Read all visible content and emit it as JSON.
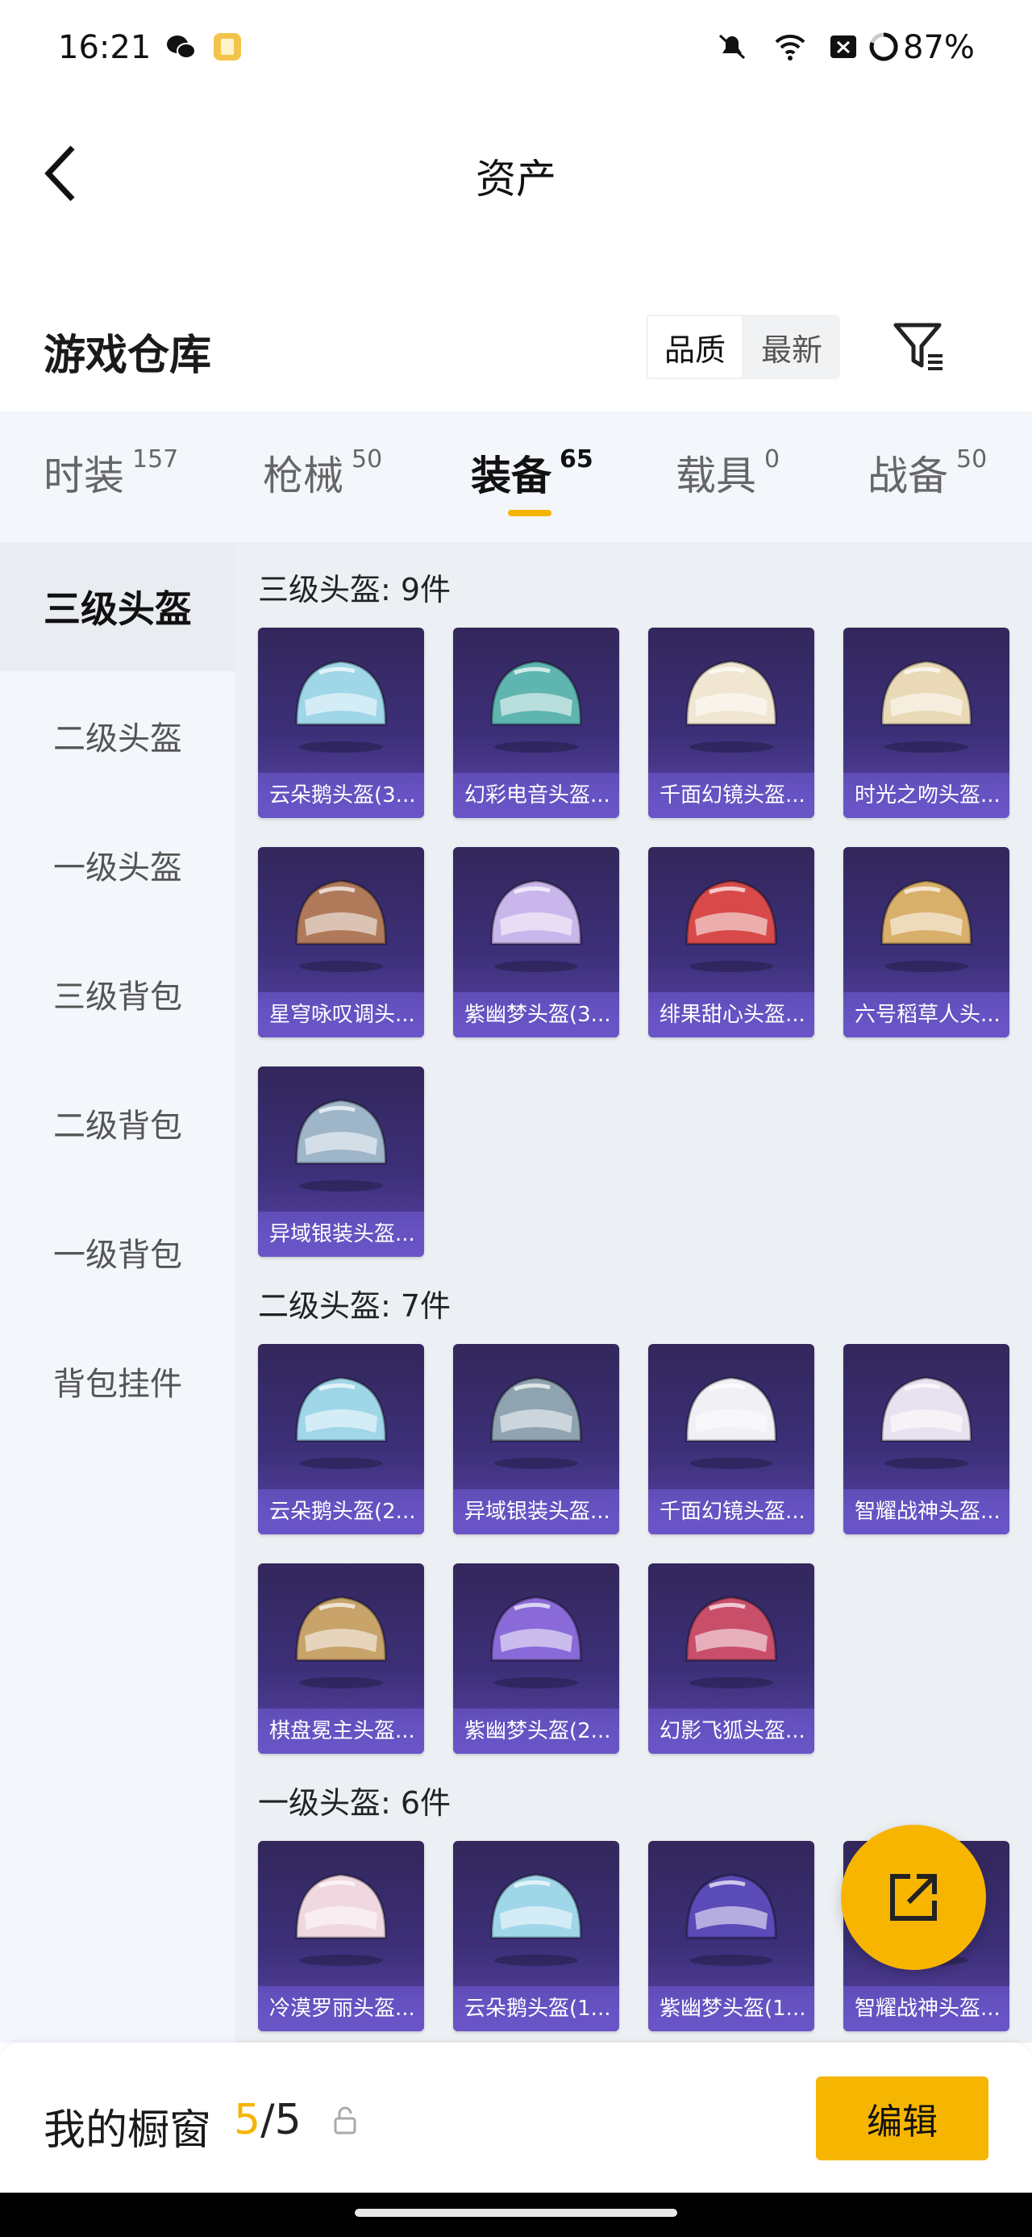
{
  "status_bar": {
    "time": "16:21",
    "battery": "87%",
    "icons": [
      "wechat-icon",
      "notes-app-icon",
      "mute-icon",
      "wifi-icon",
      "sim-icon",
      "battery-icon"
    ]
  },
  "nav": {
    "title": "资产",
    "back_icon": "chevron-left-icon"
  },
  "header": {
    "title": "游戏仓库",
    "sort_options": [
      "品质",
      "最新"
    ],
    "active_sort": "品质",
    "filter_icon": "filter-icon"
  },
  "tabs": [
    {
      "label": "时装",
      "count": "157"
    },
    {
      "label": "枪械",
      "count": "50"
    },
    {
      "label": "装备",
      "count": "65"
    },
    {
      "label": "载具",
      "count": "0"
    },
    {
      "label": "战备",
      "count": "50"
    }
  ],
  "active_tab": "装备",
  "sidebar": {
    "items": [
      "三级头盔",
      "二级头盔",
      "一级头盔",
      "三级背包",
      "二级背包",
      "一级背包",
      "背包挂件"
    ],
    "active": "三级头盔"
  },
  "groups": [
    {
      "title": "三级头盔: 9件",
      "items": [
        "云朵鹅头盔(3...",
        "幻彩电音头盔...",
        "千面幻镜头盔...",
        "时光之吻头盔...",
        "星穹咏叹调头...",
        "紫幽梦头盔(3...",
        "绯果甜心头盔...",
        "六号稻草人头...",
        "异域银装头盔..."
      ]
    },
    {
      "title": "二级头盔: 7件",
      "items": [
        "云朵鹅头盔(2...",
        "异域银装头盔...",
        "千面幻镜头盔...",
        "智耀战神头盔...",
        "棋盘冕主头盔...",
        "紫幽梦头盔(2...",
        "幻影飞狐头盔..."
      ]
    },
    {
      "title": "一级头盔: 6件",
      "items": [
        "冷漠罗丽头盔...",
        "云朵鹅头盔(1...",
        "紫幽梦头盔(1...",
        "智耀战神头盔..."
      ]
    }
  ],
  "fab": {
    "icon": "share-external-icon"
  },
  "bottom_bar": {
    "label": "我的橱窗",
    "current": "5",
    "separator": "/",
    "total": "5",
    "lock_icon": "lock-icon",
    "edit_label": "编辑"
  },
  "colors": {
    "accent": "#f5b400",
    "card_top": "#33275c",
    "card_bottom": "#5a45a8"
  }
}
